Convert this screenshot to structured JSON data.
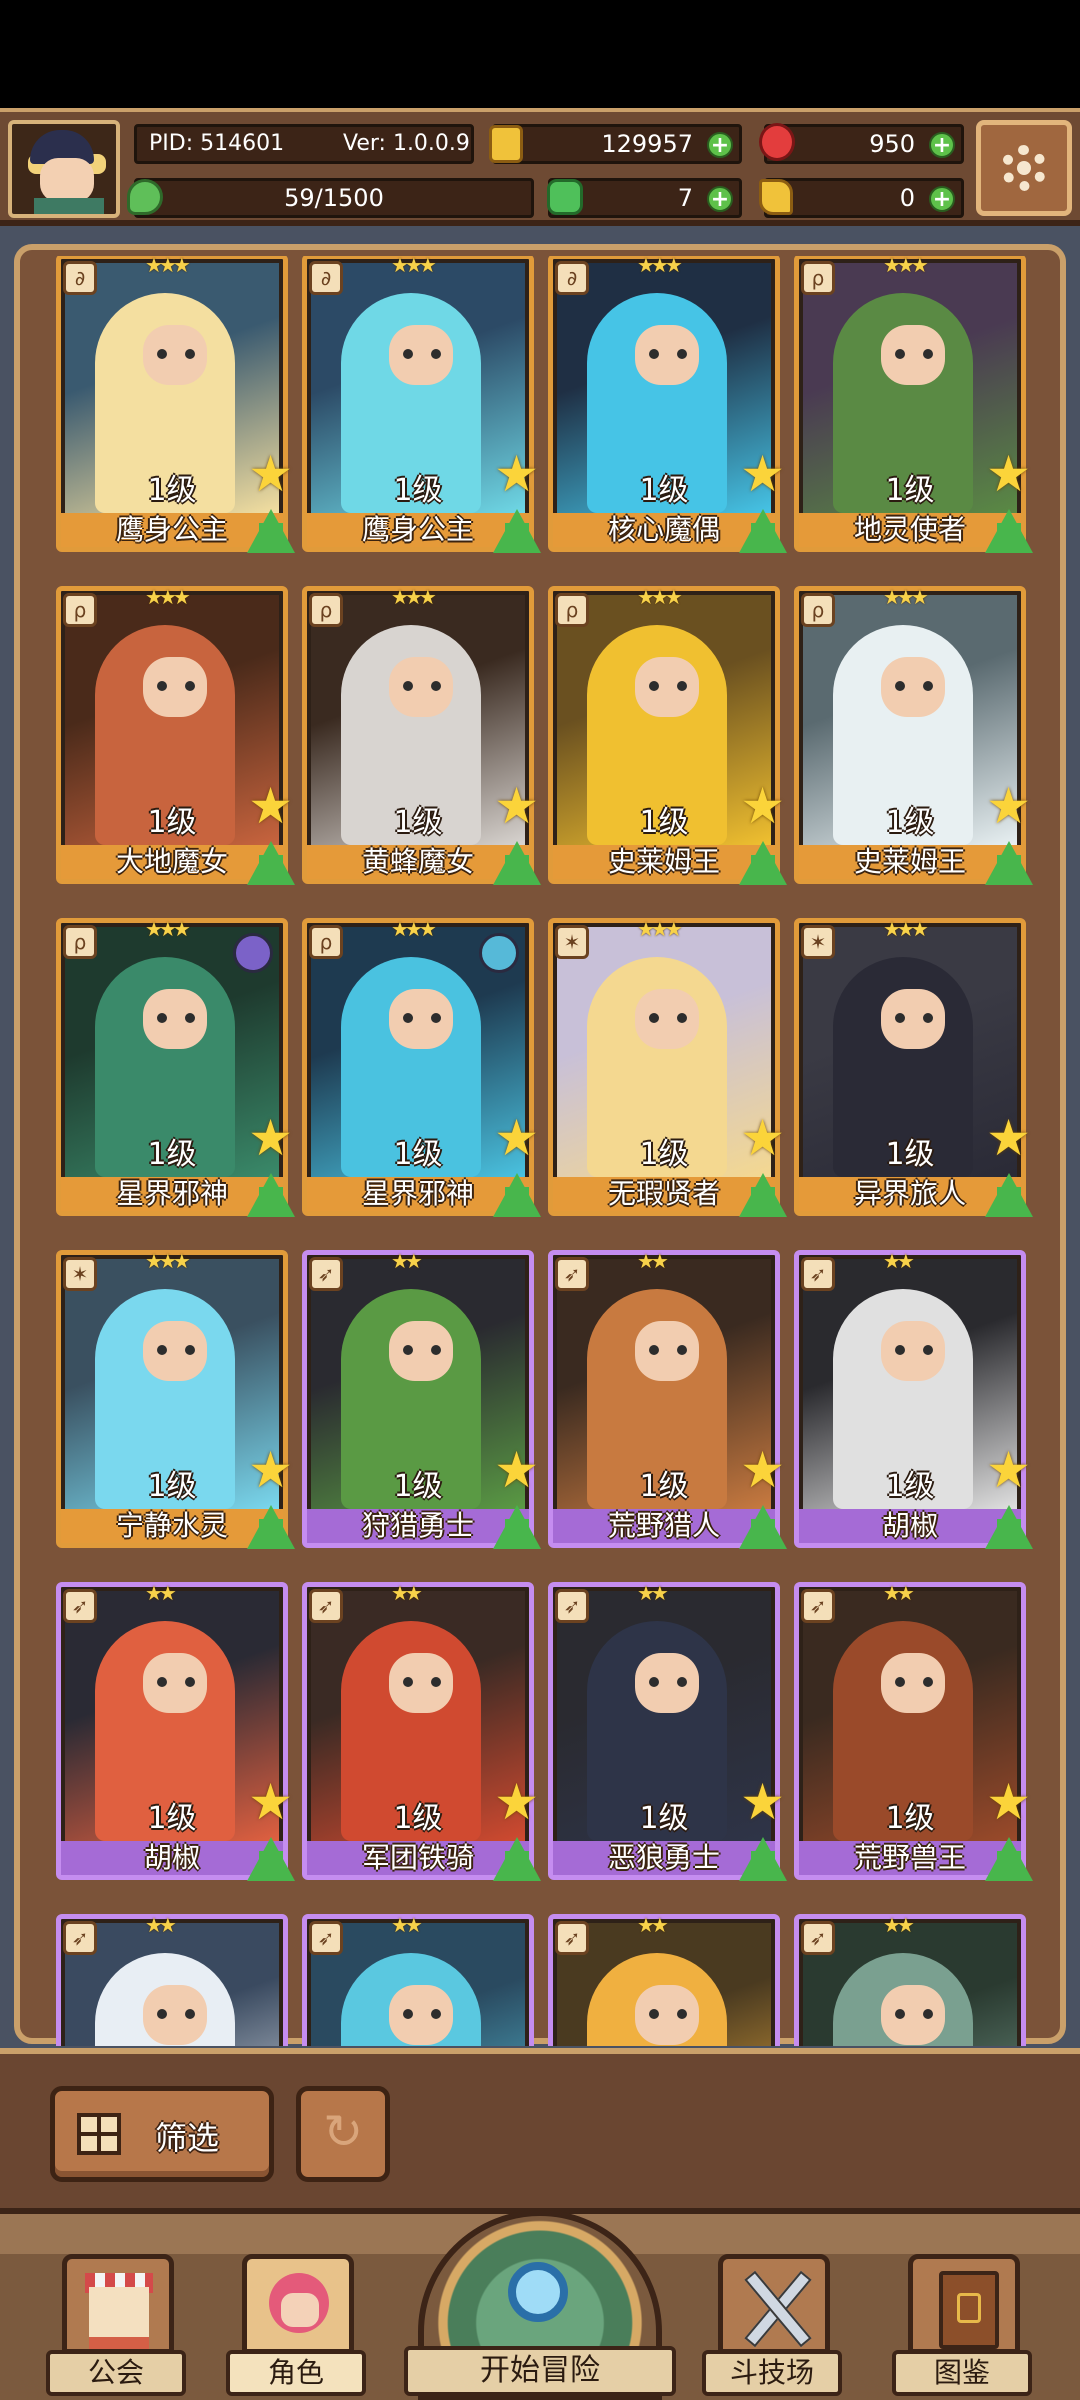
{
  "header": {
    "pid": "PID: 514601",
    "version": "Ver: 1.0.0.9",
    "gold": "129957",
    "gems": "950",
    "energy": "59/1500",
    "clovers": "7",
    "scrolls": "0"
  },
  "cards": [
    {
      "level": "1级",
      "name": "鹰身公主",
      "stars": "★★★",
      "rarity": "orange",
      "icon": "link-icon",
      "palette": [
        "#3a5a70",
        "#f4dfa0"
      ]
    },
    {
      "level": "1级",
      "name": "鹰身公主",
      "stars": "★★★",
      "rarity": "orange",
      "icon": "link-icon",
      "palette": [
        "#2c4a66",
        "#6fd8e6"
      ]
    },
    {
      "level": "1级",
      "name": "核心魔偶",
      "stars": "★★★",
      "rarity": "orange",
      "icon": "link-icon",
      "palette": [
        "#1f2f44",
        "#46c4e6"
      ]
    },
    {
      "level": "1级",
      "name": "地灵使者",
      "stars": "★★★",
      "rarity": "orange",
      "icon": "staff-icon",
      "palette": [
        "#4a3a52",
        "#5a8a44"
      ]
    },
    {
      "level": "1级",
      "name": "大地魔女",
      "stars": "★★★",
      "rarity": "orange",
      "icon": "staff-icon",
      "palette": [
        "#4a2a1a",
        "#c8643e"
      ]
    },
    {
      "level": "1级",
      "name": "黄蜂魔女",
      "stars": "★★★",
      "rarity": "orange",
      "icon": "staff-icon",
      "palette": [
        "#3a2a20",
        "#d8d4d0"
      ]
    },
    {
      "level": "1级",
      "name": "史莱姆王",
      "stars": "★★★",
      "rarity": "orange",
      "icon": "staff-icon",
      "palette": [
        "#6a5020",
        "#f0c030"
      ]
    },
    {
      "level": "1级",
      "name": "史莱姆王",
      "stars": "★★★",
      "rarity": "orange",
      "icon": "staff-icon",
      "palette": [
        "#5a6a70",
        "#e8f0f2"
      ]
    },
    {
      "level": "1级",
      "name": "星界邪神",
      "stars": "★★★",
      "rarity": "orange",
      "icon": "staff-icon",
      "palette": [
        "#1e3a2e",
        "#3a8a6a"
      ]
    },
    {
      "level": "1级",
      "name": "星界邪神",
      "stars": "★★★",
      "rarity": "orange",
      "icon": "staff-icon",
      "palette": [
        "#1e3a50",
        "#4ac2e0"
      ]
    },
    {
      "level": "1级",
      "name": "无瑕贤者",
      "stars": "★★★",
      "rarity": "orange",
      "icon": "cross-icon",
      "palette": [
        "#c8c0d8",
        "#f4d890"
      ]
    },
    {
      "level": "1级",
      "name": "异界旅人",
      "stars": "★★★",
      "rarity": "orange",
      "icon": "cross-icon",
      "palette": [
        "#3a3a44",
        "#2a2a36"
      ]
    },
    {
      "level": "1级",
      "name": "宁静水灵",
      "stars": "★★★",
      "rarity": "orange",
      "icon": "cross-icon",
      "palette": [
        "#3a5060",
        "#7ad8ee"
      ]
    },
    {
      "level": "1级",
      "name": "狩猎勇士",
      "stars": "★★",
      "rarity": "purple",
      "icon": "bow-icon",
      "palette": [
        "#2a2a30",
        "#5a9a44"
      ]
    },
    {
      "level": "1级",
      "name": "荒野猎人",
      "stars": "★★",
      "rarity": "purple",
      "icon": "bow-icon",
      "palette": [
        "#3a2a20",
        "#c87a40"
      ]
    },
    {
      "level": "1级",
      "name": "胡椒",
      "stars": "★★",
      "rarity": "purple",
      "icon": "bow-icon",
      "palette": [
        "#2a2a2e",
        "#e0e0e0"
      ]
    },
    {
      "level": "1级",
      "name": "胡椒",
      "stars": "★★",
      "rarity": "purple",
      "icon": "bow-icon",
      "palette": [
        "#2a2a34",
        "#e06040"
      ]
    },
    {
      "level": "1级",
      "name": "军团铁骑",
      "stars": "★★",
      "rarity": "purple",
      "icon": "bow-icon",
      "palette": [
        "#3a2a24",
        "#d04a30"
      ]
    },
    {
      "level": "1级",
      "name": "恶狼勇士",
      "stars": "★★",
      "rarity": "purple",
      "icon": "bow-icon",
      "palette": [
        "#2a2a30",
        "#2e3448"
      ]
    },
    {
      "level": "1级",
      "name": "荒野兽王",
      "stars": "★★",
      "rarity": "purple",
      "icon": "bow-icon",
      "palette": [
        "#3a2a20",
        "#9a4a2a"
      ]
    },
    {
      "level": "",
      "name": "",
      "stars": "★★",
      "rarity": "purple",
      "icon": "bow-icon",
      "palette": [
        "#3a4a60",
        "#e8eef4"
      ]
    },
    {
      "level": "",
      "name": "",
      "stars": "★★",
      "rarity": "purple",
      "icon": "bow-icon",
      "palette": [
        "#2a4a60",
        "#5ac8e0"
      ]
    },
    {
      "level": "",
      "name": "",
      "stars": "★★",
      "rarity": "purple",
      "icon": "bow-icon",
      "palette": [
        "#4a3a20",
        "#f0b040"
      ]
    },
    {
      "level": "",
      "name": "",
      "stars": "★★",
      "rarity": "purple",
      "icon": "bow-icon",
      "palette": [
        "#2a3a30",
        "#7aa090"
      ]
    }
  ],
  "filter_label": "筛选",
  "nav": {
    "guild": "公会",
    "characters": "角色",
    "adventure": "开始冒险",
    "arena": "斗技场",
    "codex": "图鉴"
  }
}
